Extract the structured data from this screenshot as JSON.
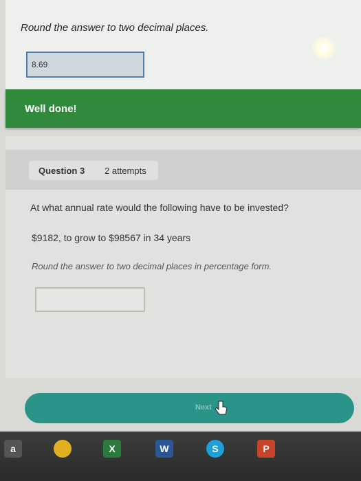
{
  "previous": {
    "question": "Round the answer to two decimal places.",
    "answer_value": "8.69",
    "feedback": "Well done!"
  },
  "question": {
    "label": "Question 3",
    "attempts": "2 attempts",
    "text": "At what annual rate would the following have to be invested?",
    "detail": "$9182, to grow to $98567 in 34 years",
    "instruction": "Round the answer to two decimal places in percentage form.",
    "answer_value": ""
  },
  "next_button": {
    "label": "Next"
  },
  "taskbar": {
    "icons": [
      {
        "name": "amazon-icon",
        "glyph": "a",
        "color": "#2d2d2d"
      },
      {
        "name": "chrome-icon",
        "glyph": "",
        "color": "#e0b020"
      },
      {
        "name": "excel-icon",
        "glyph": "X",
        "color": "#2b7a3e"
      },
      {
        "name": "word-icon",
        "glyph": "W",
        "color": "#2b5797"
      },
      {
        "name": "skype-icon",
        "glyph": "S",
        "color": "#1d9fd8"
      },
      {
        "name": "powerpoint-icon",
        "glyph": "P",
        "color": "#c6452a"
      }
    ]
  }
}
